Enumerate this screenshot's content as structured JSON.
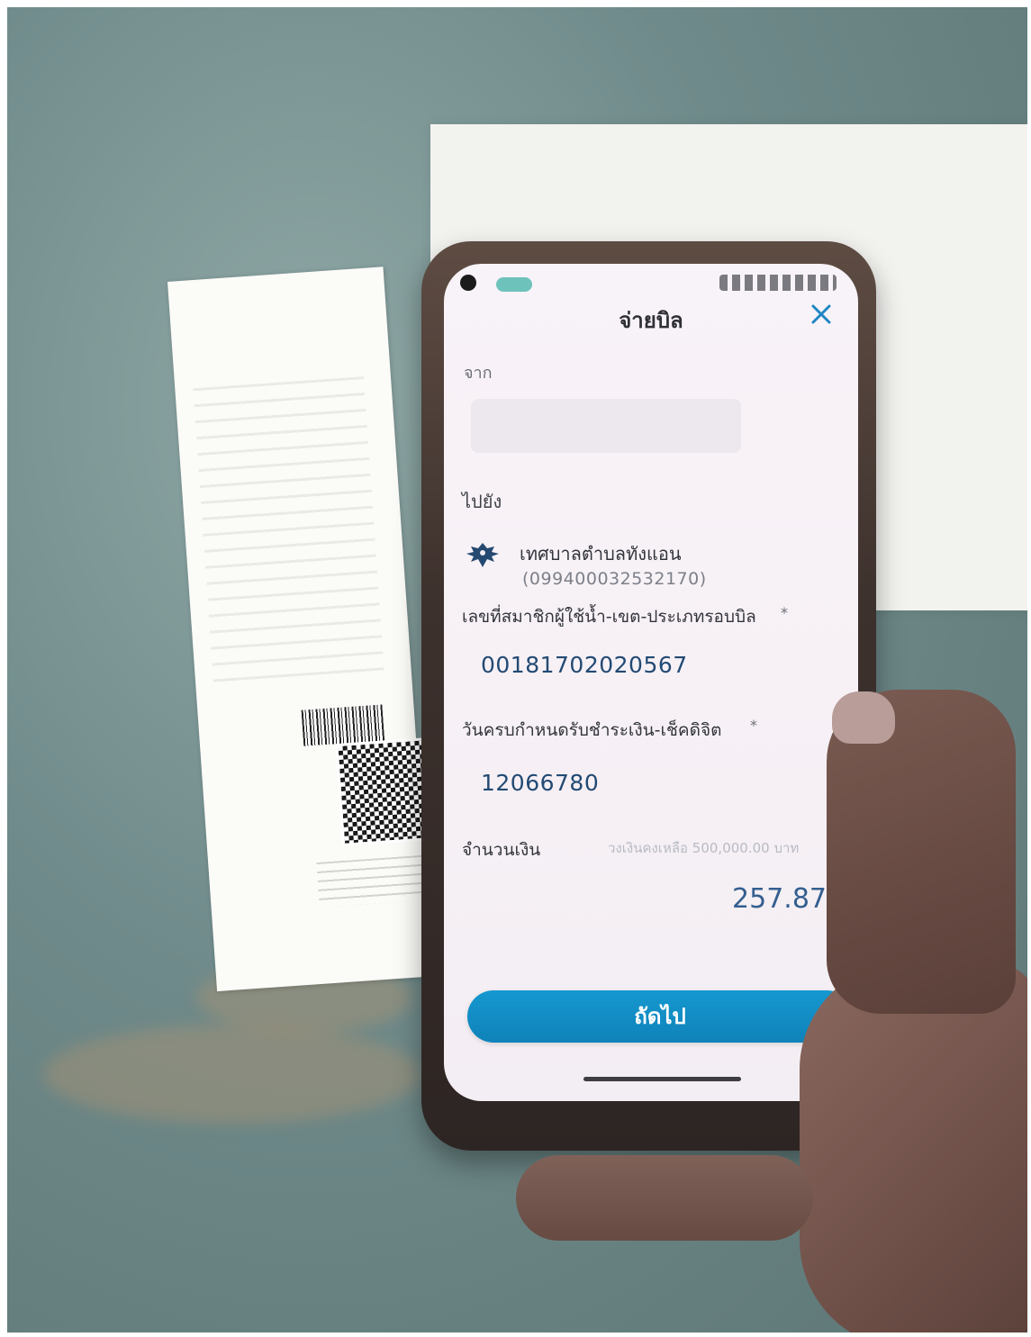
{
  "screen": {
    "title": "จ่ายบิล",
    "from_label": "จาก",
    "to_label": "ไปยัง",
    "recipient": {
      "name": "เทศบาลตำบลทังแอน",
      "account_id": "(099400032532170)"
    },
    "fields": [
      {
        "label": "เลขที่สมาชิกผู้ใช้น้ำ-เขต-ประเภทรอบบิล",
        "required_mark": "*",
        "value": "00181702020567"
      },
      {
        "label": "วันครบกำหนดรับชำระเงิน-เช็คดิจิต",
        "required_mark": "*",
        "value": "12066780"
      }
    ],
    "amount": {
      "label": "จำนวนเงิน",
      "limit_text": "วงเงินคงเหลือ 500,000.00 บาท",
      "value": "257.87"
    },
    "button_label": "ถัดไป"
  },
  "icons": {
    "close": "close-icon",
    "recipient": "garuda-icon"
  },
  "colors": {
    "primary": "#1698d0",
    "value_text": "#234a73",
    "amount_text": "#345f8f"
  }
}
